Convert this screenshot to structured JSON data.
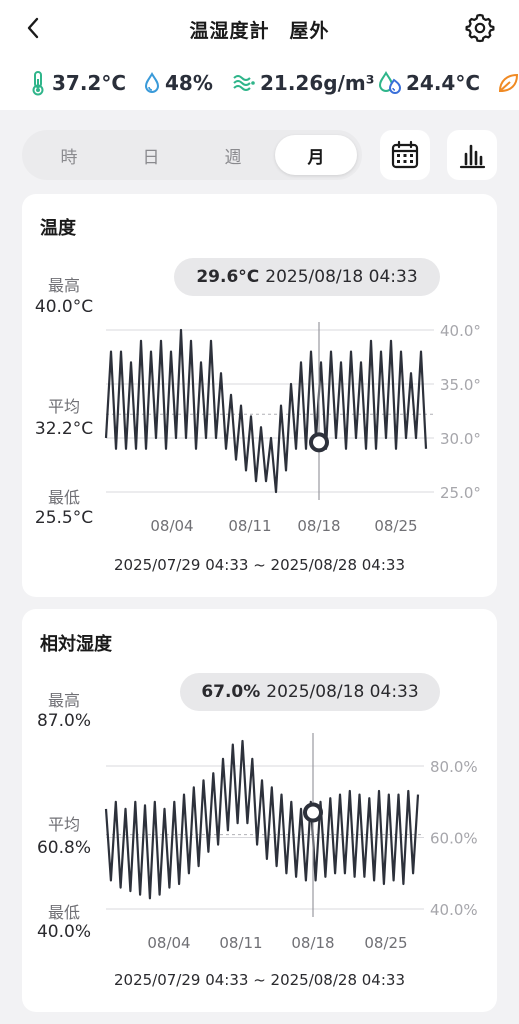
{
  "header": {
    "title": "温湿度計　屋外"
  },
  "stats": {
    "temperature": "37.2°C",
    "humidity": "48%",
    "absolute_humidity": "21.26g/m³",
    "dew_point": "24.4°C"
  },
  "segments": [
    {
      "label": "時",
      "active": false
    },
    {
      "label": "日",
      "active": false
    },
    {
      "label": "週",
      "active": false
    },
    {
      "label": "月",
      "active": true
    }
  ],
  "temperature_card": {
    "title": "温度",
    "max_label": "最高",
    "max_value": "40.0°C",
    "avg_label": "平均",
    "avg_value": "32.2°C",
    "min_label": "最低",
    "min_value": "25.5°C",
    "highlight_value": "29.6°C",
    "highlight_time": "2025/08/18 04:33",
    "range": "2025/07/29 04:33 ~ 2025/08/28 04:33"
  },
  "humidity_card": {
    "title": "相対湿度",
    "max_label": "最高",
    "max_value": "87.0%",
    "avg_label": "平均",
    "avg_value": "60.8%",
    "min_label": "最低",
    "min_value": "40.0%",
    "highlight_value": "67.0%",
    "highlight_time": "2025/08/18 04:33",
    "range": "2025/07/29 04:33 ~ 2025/08/28 04:33"
  },
  "chart_data": [
    {
      "type": "line",
      "x_ticks": [
        "08/04",
        "08/11",
        "08/18",
        "08/25"
      ],
      "y_ticks": [
        "25.0°",
        "30.0°",
        "35.0°",
        "40.0°"
      ],
      "ylim": [
        25,
        40
      ],
      "average": 32.2,
      "cursor": {
        "x": "08/18 04:33",
        "y": 29.6
      },
      "series": [
        {
          "values": [
            30,
            38,
            29,
            38,
            29,
            37,
            29,
            39,
            29,
            38,
            30,
            39,
            29,
            38,
            30,
            40,
            30,
            39,
            29,
            37,
            30,
            39,
            30,
            36,
            29,
            34,
            28,
            33,
            27,
            32,
            26,
            31,
            26,
            30,
            25,
            33,
            27,
            35,
            29,
            37,
            29,
            38,
            30,
            37,
            29,
            38,
            30,
            37,
            29,
            38,
            30,
            37,
            29,
            39,
            29,
            38,
            30,
            39,
            29,
            38,
            30,
            36,
            30,
            38,
            29
          ]
        }
      ]
    },
    {
      "type": "line",
      "x_ticks": [
        "08/04",
        "08/11",
        "08/18",
        "08/25"
      ],
      "y_ticks": [
        "40.0%",
        "60.0%",
        "80.0%"
      ],
      "ylim": [
        40,
        80
      ],
      "average": 60.8,
      "cursor": {
        "x": "08/18 04:33",
        "y": 67.0
      },
      "series": [
        {
          "values": [
            68,
            48,
            70,
            46,
            68,
            45,
            70,
            44,
            69,
            43,
            70,
            44,
            68,
            46,
            70,
            47,
            72,
            50,
            74,
            52,
            76,
            56,
            78,
            58,
            82,
            62,
            86,
            64,
            87,
            64,
            82,
            58,
            76,
            54,
            74,
            52,
            72,
            50,
            70,
            49,
            68,
            48,
            70,
            48,
            70,
            49,
            71,
            50,
            72,
            50,
            73,
            49,
            72,
            49,
            71,
            48,
            73,
            47,
            72,
            48,
            72,
            47,
            73,
            50,
            72
          ]
        }
      ]
    }
  ]
}
